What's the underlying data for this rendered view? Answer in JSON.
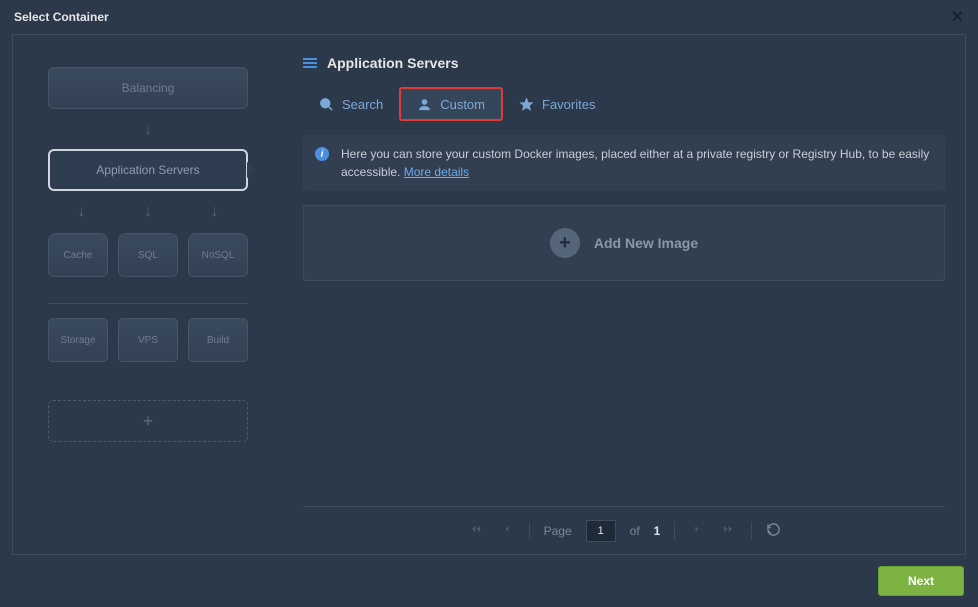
{
  "title": "Select Container",
  "sidebar": {
    "balancing": "Balancing",
    "app_servers": "Application Servers",
    "nodes": {
      "cache": "Cache",
      "sql": "SQL",
      "nosql": "NoSQL",
      "storage": "Storage",
      "vps": "VPS",
      "build": "Build"
    }
  },
  "main": {
    "heading": "Application Servers",
    "tabs": {
      "search": "Search",
      "custom": "Custom",
      "favorites": "Favorites"
    },
    "info_text": "Here you can store your custom Docker images, placed either at a private registry or Registry Hub, to be easily accessible.",
    "info_link": "More details",
    "add_image_label": "Add New Image"
  },
  "pager": {
    "page_label": "Page",
    "page_value": "1",
    "of_label": "of",
    "total": "1"
  },
  "footer": {
    "next": "Next"
  }
}
